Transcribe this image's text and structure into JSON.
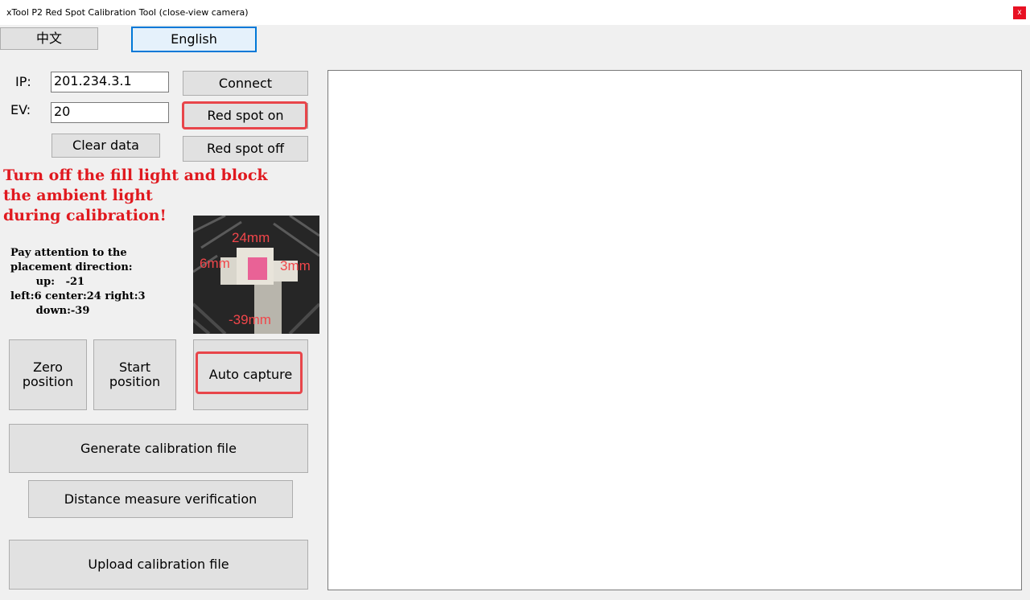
{
  "window": {
    "title": "xTool P2 Red Spot Calibration Tool (close-view camera)",
    "close_label": "x"
  },
  "language": {
    "chinese": "中文",
    "english": "English"
  },
  "fields": {
    "ip_label": "IP:",
    "ip_value": "201.234.3.1",
    "ev_label": "EV:",
    "ev_value": "20"
  },
  "buttons": {
    "connect": "Connect",
    "red_spot_on": "Red spot on",
    "red_spot_off": "Red spot off",
    "clear_data": "Clear data",
    "zero_position_line1": "Zero",
    "zero_position_line2": "position",
    "start_position_line1": "Start",
    "start_position_line2": "position",
    "auto_capture": "Auto capture",
    "generate_calibration": "Generate calibration file",
    "distance_verification": "Distance measure verification",
    "upload_calibration": "Upload calibration file"
  },
  "warning": {
    "line1": "Turn off the fill light and block",
    "line2": "the ambient light",
    "line3": "during calibration!"
  },
  "instructions": {
    "line1": "Pay attention to the",
    "line2": "placement direction:",
    "line3": "       up:   -21",
    "line4": "left:6 center:24 right:3",
    "line5": "       down:-39"
  },
  "photo_labels": {
    "top": "24mm",
    "left": "6mm",
    "right": "3mm",
    "bottom": "-39mm"
  },
  "colors": {
    "warning": "#e0191f",
    "highlight_ring": "#e8454a",
    "focus_border": "#0078d7"
  }
}
